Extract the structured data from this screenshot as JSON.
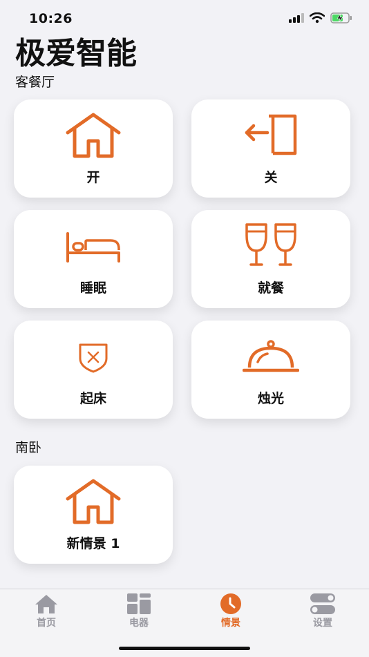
{
  "status_bar": {
    "time": "10:26"
  },
  "title": "极爱智能",
  "sections": [
    {
      "label": "客餐厅"
    },
    {
      "label": "南卧"
    }
  ],
  "scenes": {
    "kecanting": [
      {
        "label": "开",
        "icon": "house-icon"
      },
      {
        "label": "关",
        "icon": "exit-door-icon"
      },
      {
        "label": "睡眠",
        "icon": "bed-icon"
      },
      {
        "label": "就餐",
        "icon": "glasses-icon"
      },
      {
        "label": "起床",
        "icon": "shield-x-icon"
      },
      {
        "label": "烛光",
        "icon": "cloche-icon"
      }
    ],
    "nanwo": [
      {
        "label": "新情景 1",
        "icon": "house-icon"
      }
    ]
  },
  "tabs": [
    {
      "label": "首页",
      "icon": "house-icon",
      "active": false
    },
    {
      "label": "电器",
      "icon": "grid-icon",
      "active": false
    },
    {
      "label": "情景",
      "icon": "clock-icon",
      "active": true
    },
    {
      "label": "设置",
      "icon": "toggles-icon",
      "active": false
    }
  ],
  "colors": {
    "accent": "#e26b28",
    "inactive": "#9a9aa2",
    "background": "#f2f2f6"
  }
}
